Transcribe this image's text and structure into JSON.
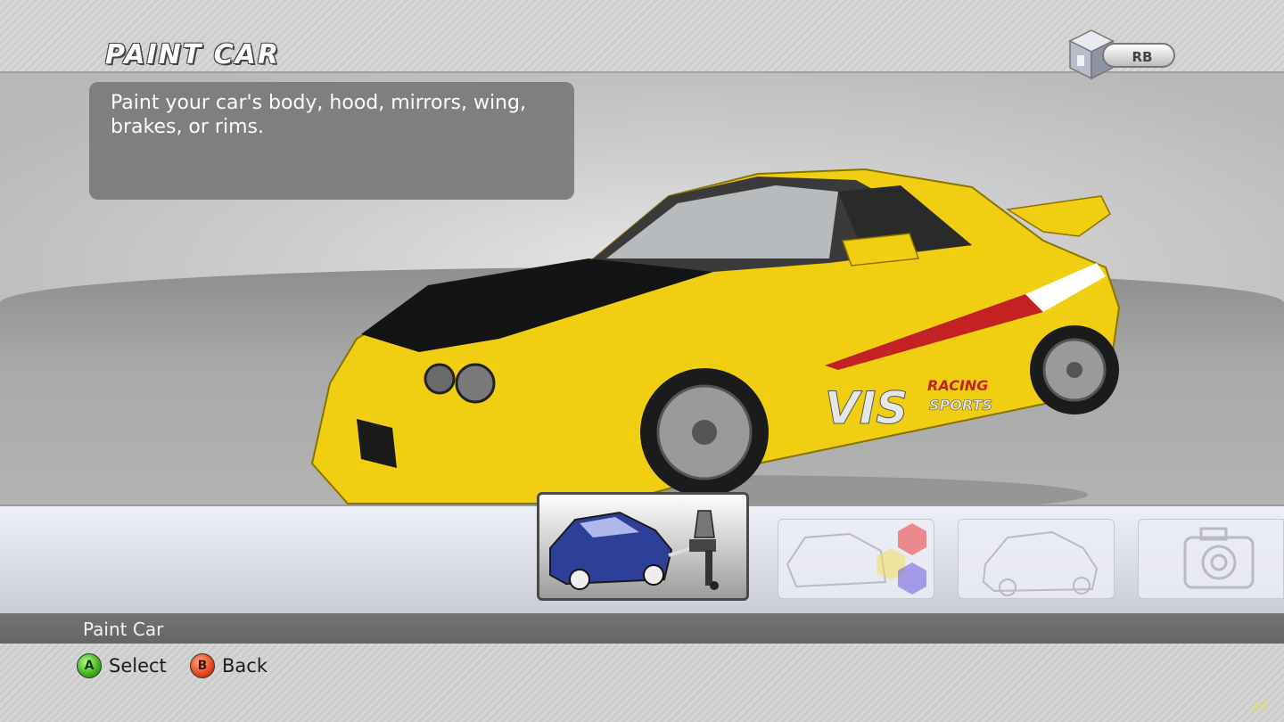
{
  "header": {
    "title": "PAINT CAR",
    "shoulder_button": "RB"
  },
  "description": "Paint your car's body, hood, mirrors, wing, brakes, or rims.",
  "carousel": {
    "items": [
      {
        "name": "Paint Car",
        "icon": "paint-spray-gun-icon",
        "selected": true
      },
      {
        "name": "",
        "icon": "vinyl-color-hexagons-icon",
        "selected": false
      },
      {
        "name": "",
        "icon": "car-view-icon",
        "selected": false
      },
      {
        "name": "",
        "icon": "camera-icon",
        "selected": false
      }
    ]
  },
  "footer": {
    "selected_label": "Paint Car",
    "buttons": [
      {
        "glyph": "A",
        "label": "Select",
        "color": "#3fb019"
      },
      {
        "glyph": "B",
        "label": "Back",
        "color": "#e2451b"
      }
    ]
  },
  "watermark": "XT",
  "car": {
    "body_color": "#f2d20f",
    "hood_color": "#141414",
    "decal_text": "VIS RACING SPORTS"
  }
}
